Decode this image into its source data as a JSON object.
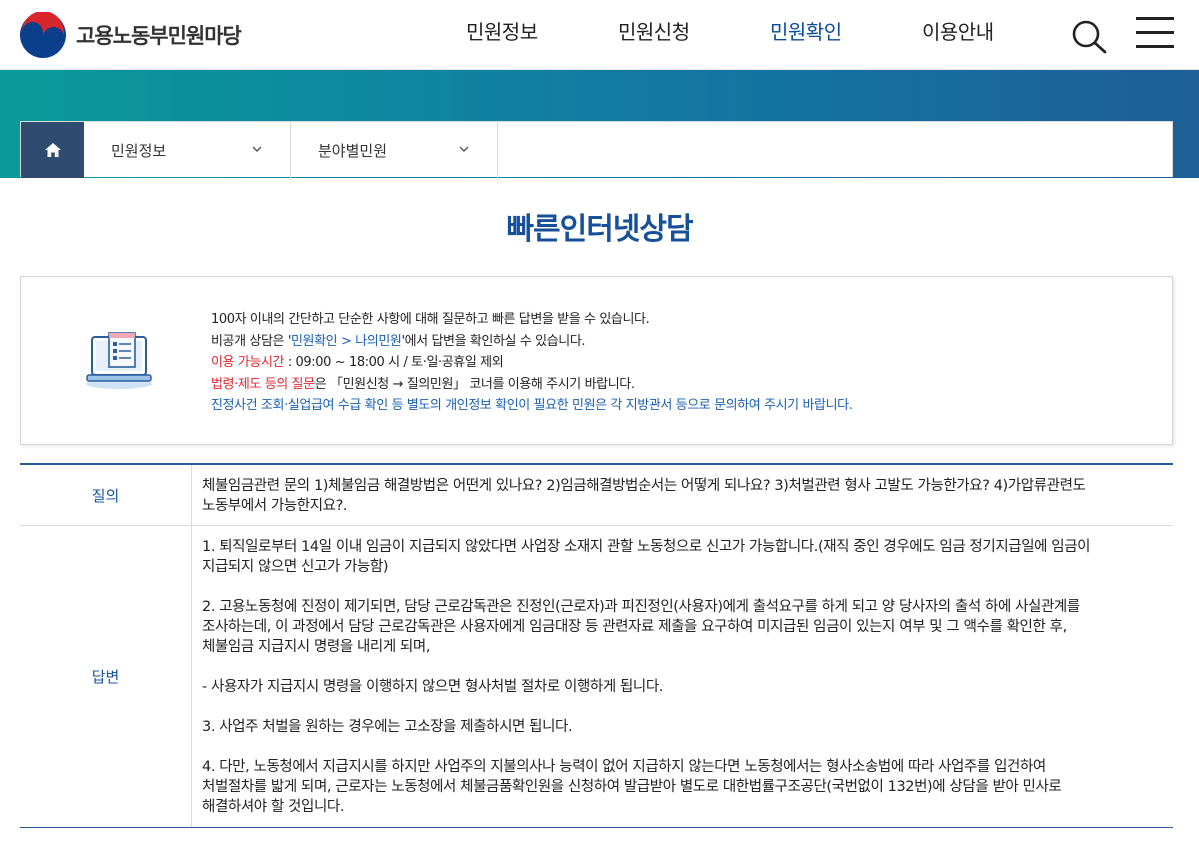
{
  "header": {
    "logo_text": "고용노동부민원마당",
    "nav": [
      {
        "label": "민원정보",
        "active": false
      },
      {
        "label": "민원신청",
        "active": false
      },
      {
        "label": "민원확인",
        "active": true
      },
      {
        "label": "이용안내",
        "active": false
      }
    ],
    "search_icon": "search-icon",
    "menu_icon": "hamburger-menu-icon"
  },
  "breadcrumb": {
    "home_icon": "home-icon",
    "level1": "민원정보",
    "level2": "분야별민원"
  },
  "page_title": "빠른인터넷상담",
  "info": {
    "icon": "laptop-form-icon",
    "line1": "100자 이내의 간단하고 단순한 사항에 대해 질문하고 빠른 답변을 받을 수 있습니다.",
    "line2_prefix": "비공개 상담은 '",
    "line2_link": "민원확인 > 나의민원",
    "line2_suffix": "'에서 답변을 확인하실 수 있습니다.",
    "hours_label": "이용 가능시간",
    "hours_value": " : 09:00 ~ 18:00 시 / 토·일·공휴일 제외",
    "law_label": "법령·제도 등의 질문",
    "law_value": "은 「민원신청 → 질의민원」 코너를 이용해 주시기 바랍니다.",
    "notice": "진정사건 조회·실업급여 수급 확인 등 별도의 개인정보 확인이 필요한 민원은 각 지방관서 등으로 문의하여 주시기 바랍니다."
  },
  "qa": {
    "question_label": "질의",
    "question_text": "체불임금관련 문의 1)체불임금 해결방법은 어떤게 있나요? 2)임금해결방법순서는 어떻게 되나요? 3)처벌관련 형사 고발도 가능한가요? 4)가압류관련도\n노동부에서 가능한지요?.",
    "answer_label": "답변",
    "answer_paragraphs": [
      "1. 퇴직일로부터 14일 이내 임금이 지급되지 않았다면 사업장 소재지 관할 노동청으로 신고가 가능합니다.(재직 중인 경우에도 임금 정기지급일에 임금이\n지급되지 않으면 신고가 가능함)",
      "2. 고용노동청에 진정이 제기되면, 담당 근로감독관은 진정인(근로자)과 피진정인(사용자)에게 출석요구를 하게 되고 양 당사자의 출석 하에 사실관계를\n조사하는데, 이 과정에서 담당 근로감독관은 사용자에게 임금대장 등 관련자료 제출을 요구하여 미지급된 임금이 있는지 여부 및 그 액수를 확인한 후,\n체불임금 지급지시 명령을 내리게 되며,",
      "- 사용자가 지급지시 명령을 이행하지 않으면 형사처벌 절차로 이행하게 됩니다.",
      "3. 사업주 처벌을 원하는 경우에는 고소장을 제출하시면 됩니다.",
      "4. 다만, 노동청에서 지급지시를 하지만 사업주의 지불의사나 능력이 없어 지급하지 않는다면 노동청에서는 형사소송법에 따라 사업주를 입건하여\n처벌절차를 밟게 되며, 근로자는 노동청에서 체불금품확인원을 신청하여 발급받아 별도로 대한법률구조공단(국번없이 132번)에 상담을 받아 민사로\n해결하셔야 할 것입니다."
    ]
  },
  "colors": {
    "primary": "#17509a",
    "nav_active": "#0a4c9a",
    "home_bg": "#2f4b70",
    "banner_start": "#0a9a9a",
    "banner_end": "#1d5f98",
    "highlight_red": "#e0262d",
    "highlight_blue": "#1a5fb5"
  }
}
